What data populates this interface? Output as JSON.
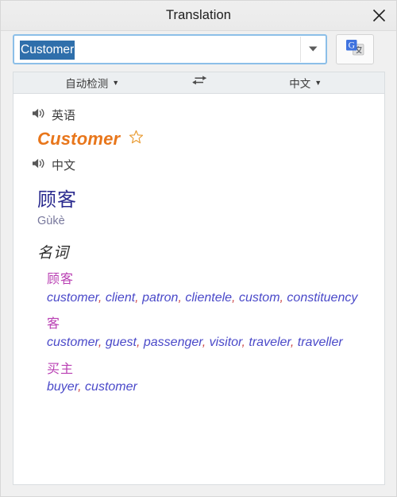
{
  "window": {
    "title": "Translation",
    "close_icon": "close-icon"
  },
  "search": {
    "value": "Customer",
    "placeholder": "",
    "selected_text": "Customer",
    "dropdown_icon": "chevron-down-icon",
    "translate_button_icon": "google-translate-icon",
    "translate_button_label": "G"
  },
  "language_bar": {
    "source": {
      "label": "自动检测",
      "caret": "▼"
    },
    "swap_icon": "swap-arrows-icon",
    "target": {
      "label": "中文",
      "caret": "▼"
    }
  },
  "result": {
    "source_language": "英语",
    "source_speaker_icon": "speaker-icon",
    "source_term": "Customer",
    "star_icon": "star-outline-icon",
    "target_language": "中文",
    "target_speaker_icon": "speaker-icon",
    "target_term": "顾客",
    "pinyin": "Gùkè",
    "part_of_speech": "名词",
    "senses": [
      {
        "term": "顾客",
        "glosses": "customer, client, patron, clientele, custom, constituency"
      },
      {
        "term": "客",
        "glosses": "customer, guest, passenger, visitor, traveler, traveller"
      },
      {
        "term": "买主",
        "glosses": "buyer, customer"
      }
    ]
  },
  "colors": {
    "source_term": "#e8761b",
    "target_term": "#2b2b8f",
    "pinyin": "#77779c",
    "sense_term": "#b93fb3",
    "gloss": "#4a49c9",
    "focus_border": "#8cbfe8",
    "selection": "#2f6fab"
  }
}
